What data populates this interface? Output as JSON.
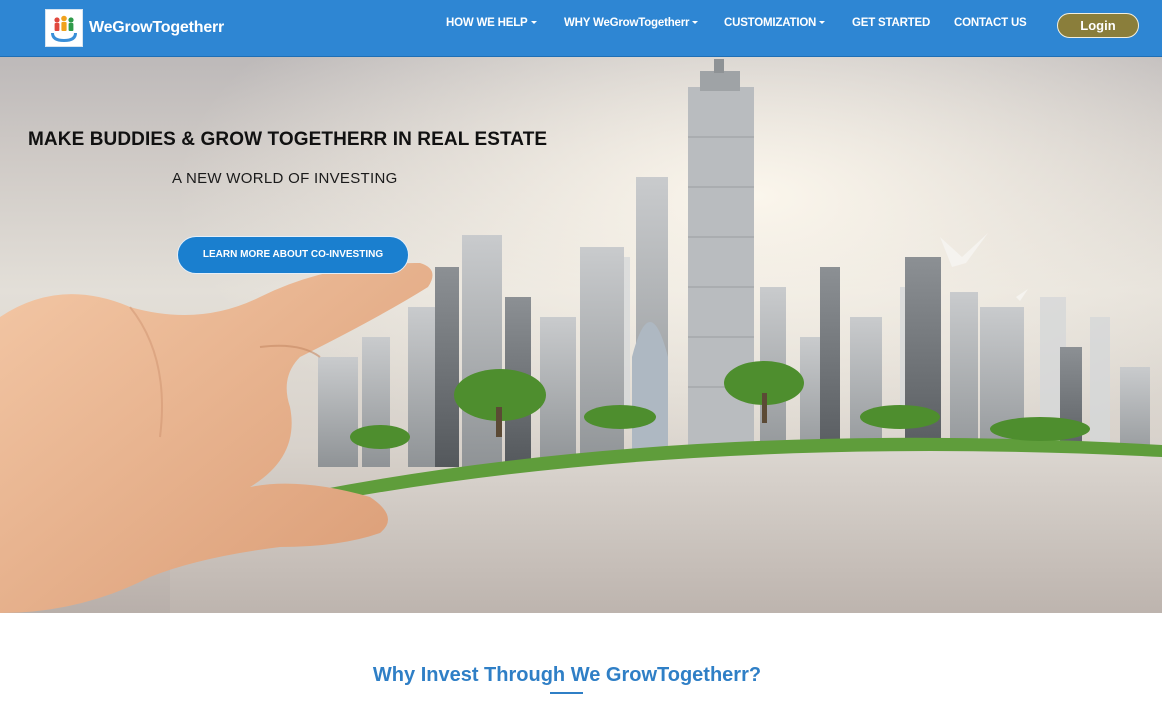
{
  "brand": {
    "name": "WeGrowTogetherr",
    "logo_icon": "people-in-hands-icon"
  },
  "nav": {
    "items": [
      {
        "label": "HOW WE HELP",
        "dropdown": true
      },
      {
        "label": "WHY WeGrowTogetherr",
        "dropdown": true
      },
      {
        "label": "CUSTOMIZATION",
        "dropdown": true
      },
      {
        "label": "GET STARTED",
        "dropdown": false
      },
      {
        "label": "CONTACT US",
        "dropdown": false
      }
    ],
    "login_label": "Login"
  },
  "hero": {
    "title": "MAKE BUDDIES & GROW TOGETHERR IN REAL ESTATE",
    "subtitle": "A NEW WORLD OF INVESTING",
    "cta_label": "LEARN MORE ABOUT CO-INVESTING"
  },
  "section": {
    "title": "Why Invest Through We GrowTogetherr?"
  },
  "colors": {
    "navbar": "#2e86d3",
    "login_button": "#8a7e3b",
    "cta_button": "#1a7fcf",
    "section_title": "#2f7fc6"
  }
}
